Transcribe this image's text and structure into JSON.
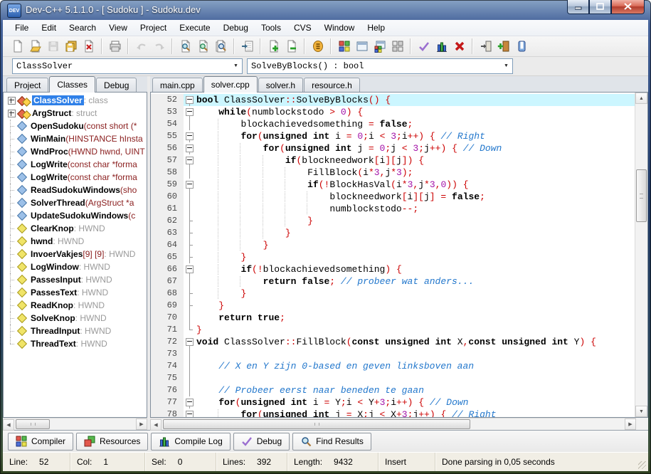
{
  "window": {
    "title": "Dev-C++ 5.1.1.0 - [ Sudoku ] - Sudoku.dev",
    "app_icon_text": "DEV"
  },
  "menu": {
    "items": [
      "File",
      "Edit",
      "Search",
      "View",
      "Project",
      "Execute",
      "Debug",
      "Tools",
      "CVS",
      "Window",
      "Help"
    ]
  },
  "toolbar": {
    "groups": [
      {
        "icons": [
          {
            "name": "new-file-icon"
          },
          {
            "name": "open-file-icon"
          },
          {
            "name": "save-icon",
            "disabled": true
          },
          {
            "name": "save-all-icon"
          },
          {
            "name": "close-file-icon"
          }
        ]
      },
      {
        "icons": [
          {
            "name": "print-icon"
          }
        ]
      },
      {
        "icons": [
          {
            "name": "undo-icon",
            "disabled": true
          },
          {
            "name": "redo-icon",
            "disabled": true
          }
        ]
      },
      {
        "icons": [
          {
            "name": "find-icon"
          },
          {
            "name": "replace-icon"
          },
          {
            "name": "find-in-files-icon"
          }
        ]
      },
      {
        "icons": [
          {
            "name": "goto-line-icon"
          }
        ]
      },
      {
        "icons": [
          {
            "name": "add-to-project-icon"
          },
          {
            "name": "remove-from-project-icon"
          }
        ]
      },
      {
        "icons": [
          {
            "name": "project-properties-icon"
          }
        ]
      },
      {
        "icons": [
          {
            "name": "compile-icon"
          },
          {
            "name": "run-icon"
          },
          {
            "name": "compile-run-icon"
          },
          {
            "name": "rebuild-icon"
          }
        ]
      },
      {
        "icons": [
          {
            "name": "syntax-check-icon"
          },
          {
            "name": "profile-icon"
          },
          {
            "name": "abort-icon"
          }
        ]
      },
      {
        "icons": [
          {
            "name": "exit-door-icon"
          },
          {
            "name": "import-door-icon"
          },
          {
            "name": "pause-icon"
          }
        ]
      }
    ]
  },
  "navigation": {
    "class_combo": {
      "value": "ClassSolver"
    },
    "member_combo": {
      "value": "SolveByBlocks() : bool"
    }
  },
  "left_panel": {
    "tabs": [
      {
        "label": "Project",
        "active": false
      },
      {
        "label": "Classes",
        "active": true
      },
      {
        "label": "Debug",
        "active": false
      }
    ],
    "tree": [
      {
        "name": "ClassSolver",
        "type": " : class",
        "kind": "class",
        "expandable": true,
        "selected": true
      },
      {
        "name": "ArgStruct",
        "type": " : struct",
        "kind": "class",
        "expandable": true
      },
      {
        "name": "OpenSudoku",
        "args": " (const short (*",
        "kind": "function"
      },
      {
        "name": "WinMain",
        "args": " (HINSTANCE hInsta",
        "kind": "function"
      },
      {
        "name": "WndProc",
        "args": " (HWND hwnd, UINT",
        "kind": "function"
      },
      {
        "name": "LogWrite",
        "args": " (const char *forma",
        "kind": "function"
      },
      {
        "name": "LogWrite",
        "args": " (const char *forma",
        "kind": "function"
      },
      {
        "name": "ReadSudokuWindows",
        "args": " (sho",
        "kind": "function"
      },
      {
        "name": "SolverThread",
        "args": " (ArgStruct *a",
        "kind": "function"
      },
      {
        "name": "UpdateSudokuWindows",
        "args": " (c",
        "kind": "function"
      },
      {
        "name": "ClearKnop",
        "type": " : HWND",
        "kind": "variable"
      },
      {
        "name": "hwnd",
        "type": " : HWND",
        "kind": "variable"
      },
      {
        "name": "InvoerVakjes",
        "args": " [9] [9]",
        "type": " : HWND",
        "kind": "variable"
      },
      {
        "name": "LogWindow",
        "type": " : HWND",
        "kind": "variable"
      },
      {
        "name": "PassesInput",
        "type": " : HWND",
        "kind": "variable"
      },
      {
        "name": "PassesText",
        "type": " : HWND",
        "kind": "variable"
      },
      {
        "name": "ReadKnop",
        "type": " : HWND",
        "kind": "variable"
      },
      {
        "name": "SolveKnop",
        "type": " : HWND",
        "kind": "variable"
      },
      {
        "name": "ThreadInput",
        "type": " : HWND",
        "kind": "variable"
      },
      {
        "name": "ThreadText",
        "type": " : HWND",
        "kind": "variable"
      }
    ]
  },
  "editor": {
    "tabs": [
      {
        "label": "main.cpp",
        "active": false
      },
      {
        "label": "solver.cpp",
        "active": true
      },
      {
        "label": "solver.h",
        "active": false
      },
      {
        "label": "resource.h",
        "active": false
      }
    ],
    "lines": [
      {
        "num": 52,
        "fold": "box",
        "hl": true,
        "text": "bool ClassSolver::SolveByBlocks() {"
      },
      {
        "num": 53,
        "fold": "box",
        "text": "    while(numblockstodo > 0) {"
      },
      {
        "num": 54,
        "fold": "v",
        "text": "        blockachievedsomething = false;"
      },
      {
        "num": 55,
        "fold": "box",
        "text": "        for(unsigned int i = 0;i < 3;i++) { // Right"
      },
      {
        "num": 56,
        "fold": "box",
        "text": "            for(unsigned int j = 0;j < 3;j++) { // Down"
      },
      {
        "num": 57,
        "fold": "box",
        "text": "                if(blockneedwork[i][j]) {"
      },
      {
        "num": 58,
        "fold": "v",
        "text": "                    FillBlock(i*3,j*3);"
      },
      {
        "num": 59,
        "fold": "box",
        "text": "                    if(!BlockHasVal(i*3,j*3,0)) {"
      },
      {
        "num": 60,
        "fold": "v",
        "text": "                        blockneedwork[i][j] = false;"
      },
      {
        "num": 61,
        "fold": "v",
        "text": "                        numblockstodo--;"
      },
      {
        "num": 62,
        "fold": "t",
        "text": "                    }"
      },
      {
        "num": 63,
        "fold": "t",
        "text": "                }"
      },
      {
        "num": 64,
        "fold": "t",
        "text": "            }"
      },
      {
        "num": 65,
        "fold": "t",
        "text": "        }"
      },
      {
        "num": 66,
        "fold": "box",
        "text": "        if(!blockachievedsomething) {"
      },
      {
        "num": 67,
        "fold": "v",
        "text": "            return false; // probeer wat anders..."
      },
      {
        "num": 68,
        "fold": "t",
        "text": "        }"
      },
      {
        "num": 69,
        "fold": "t",
        "text": "    }"
      },
      {
        "num": 70,
        "fold": "v",
        "text": "    return true;"
      },
      {
        "num": 71,
        "fold": "L",
        "text": "}"
      },
      {
        "num": 72,
        "fold": "box",
        "text": "void ClassSolver::FillBlock(const unsigned int X,const unsigned int Y) {"
      },
      {
        "num": 73,
        "fold": "v",
        "text": ""
      },
      {
        "num": 74,
        "fold": "v",
        "text": "    // X en Y zijn 0-based en geven linksboven aan"
      },
      {
        "num": 75,
        "fold": "v",
        "text": ""
      },
      {
        "num": 76,
        "fold": "v",
        "text": "    // Probeer eerst naar beneden te gaan"
      },
      {
        "num": 77,
        "fold": "box",
        "text": "    for(unsigned int i = Y;i < Y+3;i++) { // Down"
      },
      {
        "num": 78,
        "fold": "box",
        "text": "        for(unsigned int j = X;j < X+3;j++) { // Right"
      }
    ]
  },
  "bottom_tabs": [
    {
      "label": "Compiler",
      "icon": "compiler-icon"
    },
    {
      "label": "Resources",
      "icon": "resources-icon"
    },
    {
      "label": "Compile Log",
      "icon": "compile-log-icon"
    },
    {
      "label": "Debug",
      "icon": "debug-check-icon"
    },
    {
      "label": "Find Results",
      "icon": "find-results-icon"
    }
  ],
  "status_bar": {
    "segments": [
      {
        "label": "Line:",
        "value": "52"
      },
      {
        "label": "Col:",
        "value": "1"
      },
      {
        "label": "Sel:",
        "value": "0"
      },
      {
        "label": "Lines:",
        "value": "392"
      },
      {
        "label": "Length:",
        "value": "9432"
      },
      {
        "label": "",
        "value": "Insert"
      },
      {
        "label": "",
        "value": "Done parsing in 0,05 seconds"
      }
    ]
  },
  "colors": {
    "selection": "#2f80e8",
    "current_line": "#ccf6ff",
    "operator": "#cc0000",
    "number": "#a312a8",
    "comment": "#2277cc",
    "args_text": "#8b2020",
    "type_suffix": "#9a9a9a",
    "close_button": "#b13c2c"
  }
}
